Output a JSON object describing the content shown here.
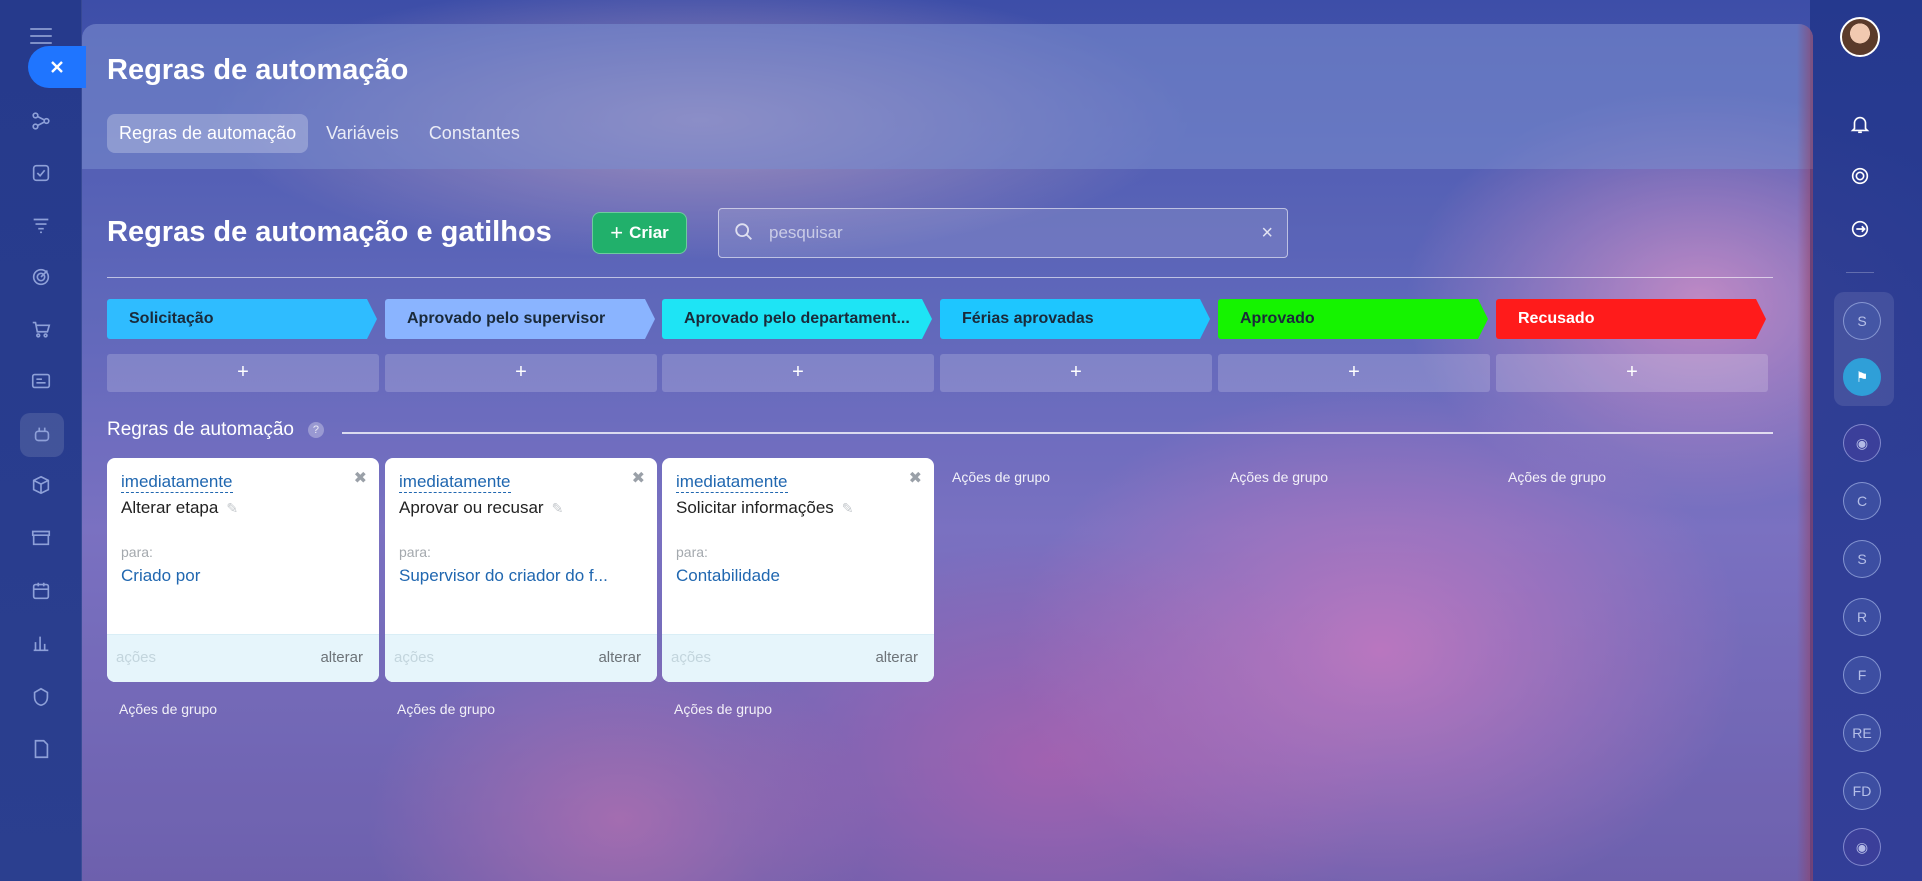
{
  "panel": {
    "title": "Regras de automação",
    "tabs": [
      {
        "label": "Regras de automação",
        "active": true
      },
      {
        "label": "Variáveis",
        "active": false
      },
      {
        "label": "Constantes",
        "active": false
      }
    ]
  },
  "main": {
    "section_title": "Regras de automação e gatilhos",
    "create_button": "Criar",
    "search_placeholder": "pesquisar",
    "stages": [
      {
        "label": "Solicitação",
        "color": "#2fbcff",
        "text_color": "#1a2a3a"
      },
      {
        "label": "Aprovado pelo supervisor",
        "color": "#8ab4ff",
        "text_color": "#1a2a3a"
      },
      {
        "label": "Aprovado pelo departament...",
        "color": "#1ee4f5",
        "text_color": "#1a2a3a"
      },
      {
        "label": "Férias aprovadas",
        "color": "#1ec6ff",
        "text_color": "#1a2a3a"
      },
      {
        "label": "Aprovado",
        "color": "#15f300",
        "text_color": "#1a2a3a"
      },
      {
        "label": "Recusado",
        "color": "#ff1b1b",
        "text_color": "#ffffff"
      }
    ],
    "add_symbol": "+",
    "rules_title": "Regras de automação",
    "help_symbol": "?",
    "cards": [
      {
        "when": "imediatamente",
        "name": "Alterar etapa",
        "para_label": "para:",
        "target": "Criado por",
        "actions_label": "ações",
        "change_label": "alterar"
      },
      {
        "when": "imediatamente",
        "name": "Aprovar ou recusar",
        "para_label": "para:",
        "target": "Supervisor do criador do f...",
        "actions_label": "ações",
        "change_label": "alterar"
      },
      {
        "when": "imediatamente",
        "name": "Solicitar informações",
        "para_label": "para:",
        "target": "Contabilidade",
        "actions_label": "ações",
        "change_label": "alterar"
      }
    ],
    "group_actions_label": "Ações de grupo"
  },
  "rightbar": {
    "letters": [
      "S",
      "C",
      "S",
      "R",
      "F",
      "RE",
      "FD"
    ]
  },
  "colors": {
    "accent": "#1f75ff",
    "create_button": "#21b06b",
    "link": "#2067b0"
  }
}
